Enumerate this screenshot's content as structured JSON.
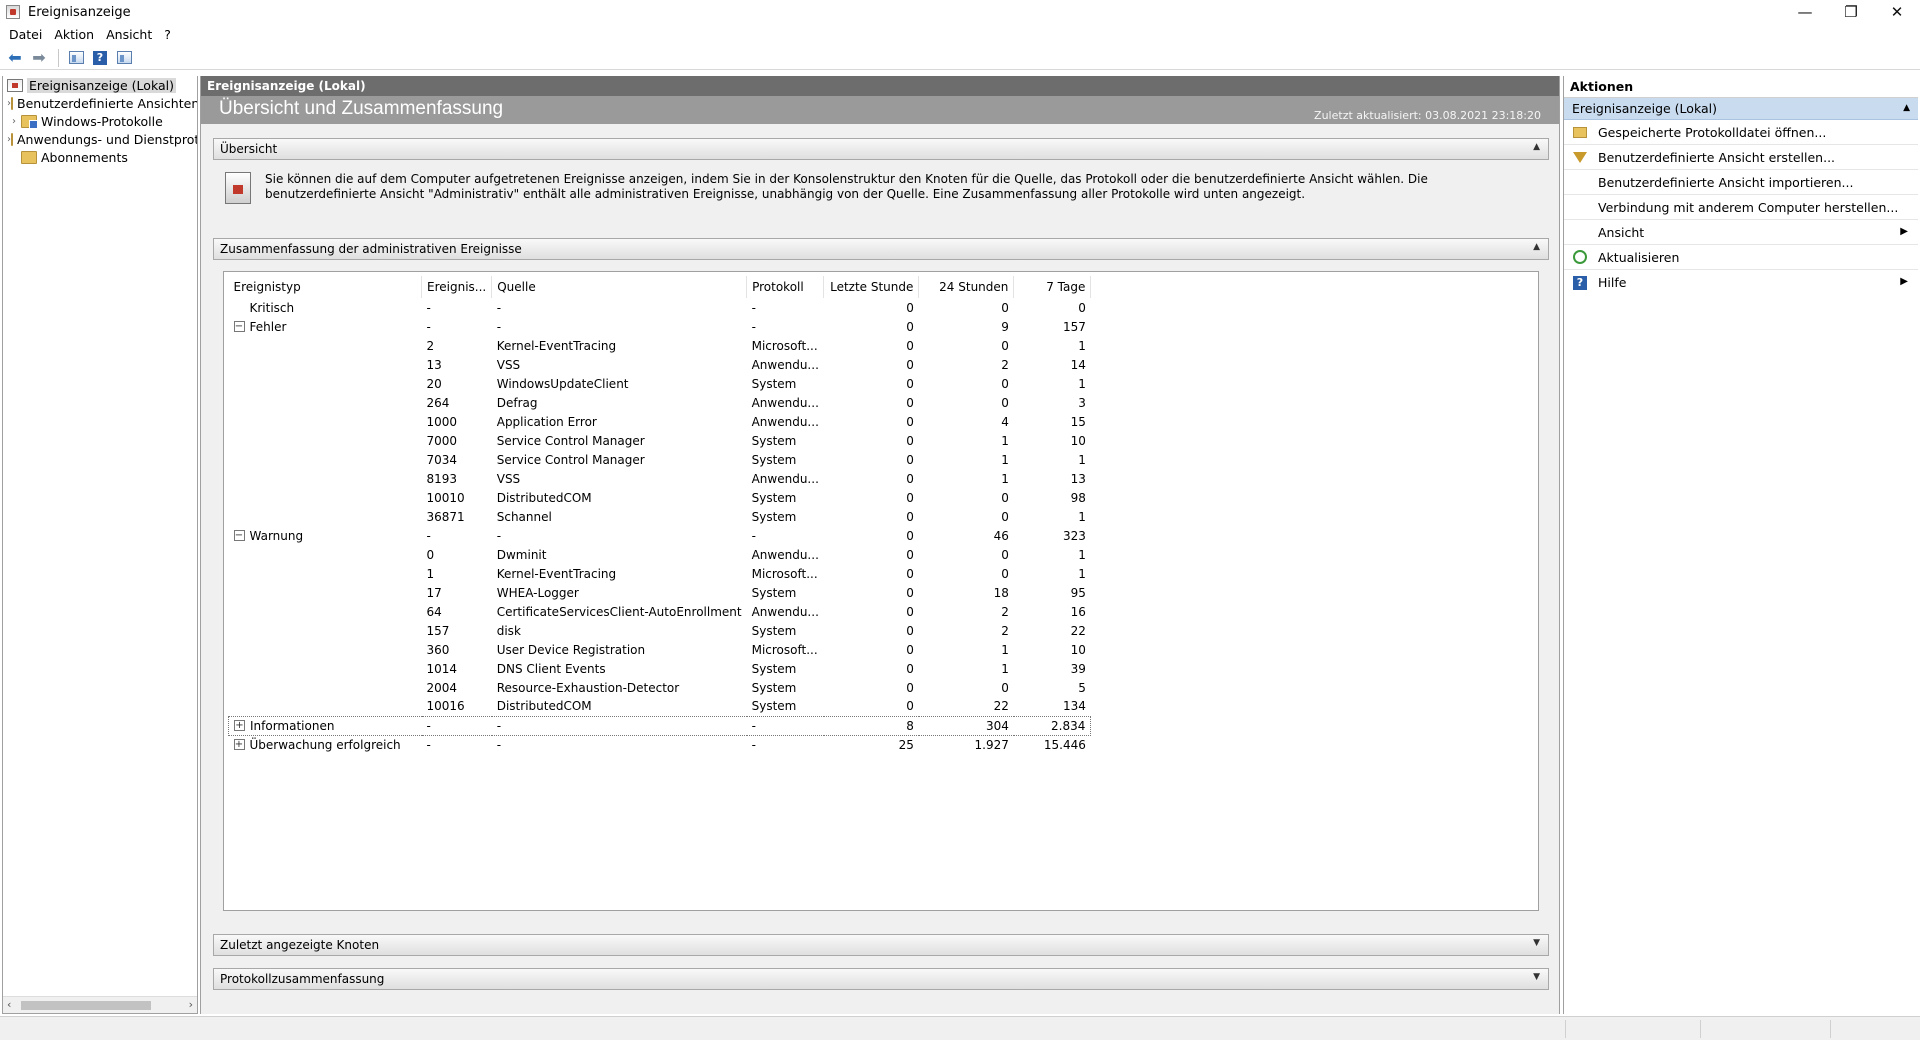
{
  "window": {
    "title": "Ereignisanzeige",
    "minimize": "—",
    "restore": "❐",
    "close": "✕"
  },
  "menu": [
    "Datei",
    "Aktion",
    "Ansicht",
    "?"
  ],
  "tree": {
    "root": "Ereignisanzeige (Lokal)",
    "items": [
      "Benutzerdefinierte Ansichten",
      "Windows-Protokolle",
      "Anwendungs- und Dienstprotokolle",
      "Abonnements"
    ]
  },
  "center": {
    "header": "Ereignisanzeige (Lokal)",
    "title": "Übersicht und Zusammenfassung",
    "updated": "Zuletzt aktualisiert: 03.08.2021 23:18:20",
    "overview_header": "Übersicht",
    "overview_text": "Sie können die auf dem Computer aufgetretenen Ereignisse anzeigen, indem Sie in der Konsolenstruktur den Knoten für die Quelle, das Protokoll oder die benutzerdefinierte Ansicht wählen. Die benutzerdefinierte Ansicht \"Administrativ\" enthält alle administrativen Ereignisse, unabhängig von der Quelle. Eine Zusammenfassung aller Protokolle wird unten angezeigt.",
    "summary_header": "Zusammenfassung der administrativen Ereignisse",
    "recent_header": "Zuletzt angezeigte Knoten",
    "log_summary_header": "Protokollzusammenfassung"
  },
  "table": {
    "columns": [
      "Ereignistyp",
      "Ereignis...",
      "Quelle",
      "Protokoll",
      "Letzte Stunde",
      "24 Stunden",
      "7 Tage"
    ],
    "rows": [
      {
        "type": "Kritisch",
        "toggle": "",
        "id": "-",
        "source": "-",
        "log": "-",
        "hour": "0",
        "day": "0",
        "week": "0"
      },
      {
        "type": "Fehler",
        "toggle": "−",
        "id": "-",
        "source": "-",
        "log": "-",
        "hour": "0",
        "day": "9",
        "week": "157"
      },
      {
        "type": "",
        "toggle": "",
        "id": "2",
        "source": "Kernel-EventTracing",
        "log": "Microsoft...",
        "hour": "0",
        "day": "0",
        "week": "1"
      },
      {
        "type": "",
        "toggle": "",
        "id": "13",
        "source": "VSS",
        "log": "Anwendu...",
        "hour": "0",
        "day": "2",
        "week": "14"
      },
      {
        "type": "",
        "toggle": "",
        "id": "20",
        "source": "WindowsUpdateClient",
        "log": "System",
        "hour": "0",
        "day": "0",
        "week": "1"
      },
      {
        "type": "",
        "toggle": "",
        "id": "264",
        "source": "Defrag",
        "log": "Anwendu...",
        "hour": "0",
        "day": "0",
        "week": "3"
      },
      {
        "type": "",
        "toggle": "",
        "id": "1000",
        "source": "Application Error",
        "log": "Anwendu...",
        "hour": "0",
        "day": "4",
        "week": "15"
      },
      {
        "type": "",
        "toggle": "",
        "id": "7000",
        "source": "Service Control Manager",
        "log": "System",
        "hour": "0",
        "day": "1",
        "week": "10"
      },
      {
        "type": "",
        "toggle": "",
        "id": "7034",
        "source": "Service Control Manager",
        "log": "System",
        "hour": "0",
        "day": "1",
        "week": "1"
      },
      {
        "type": "",
        "toggle": "",
        "id": "8193",
        "source": "VSS",
        "log": "Anwendu...",
        "hour": "0",
        "day": "1",
        "week": "13"
      },
      {
        "type": "",
        "toggle": "",
        "id": "10010",
        "source": "DistributedCOM",
        "log": "System",
        "hour": "0",
        "day": "0",
        "week": "98"
      },
      {
        "type": "",
        "toggle": "",
        "id": "36871",
        "source": "Schannel",
        "log": "System",
        "hour": "0",
        "day": "0",
        "week": "1"
      },
      {
        "type": "Warnung",
        "toggle": "−",
        "id": "-",
        "source": "-",
        "log": "-",
        "hour": "0",
        "day": "46",
        "week": "323"
      },
      {
        "type": "",
        "toggle": "",
        "id": "0",
        "source": "Dwminit",
        "log": "Anwendu...",
        "hour": "0",
        "day": "0",
        "week": "1"
      },
      {
        "type": "",
        "toggle": "",
        "id": "1",
        "source": "Kernel-EventTracing",
        "log": "Microsoft...",
        "hour": "0",
        "day": "0",
        "week": "1"
      },
      {
        "type": "",
        "toggle": "",
        "id": "17",
        "source": "WHEA-Logger",
        "log": "System",
        "hour": "0",
        "day": "18",
        "week": "95"
      },
      {
        "type": "",
        "toggle": "",
        "id": "64",
        "source": "CertificateServicesClient-AutoEnrollment",
        "log": "Anwendu...",
        "hour": "0",
        "day": "2",
        "week": "16"
      },
      {
        "type": "",
        "toggle": "",
        "id": "157",
        "source": "disk",
        "log": "System",
        "hour": "0",
        "day": "2",
        "week": "22"
      },
      {
        "type": "",
        "toggle": "",
        "id": "360",
        "source": "User Device Registration",
        "log": "Microsoft...",
        "hour": "0",
        "day": "1",
        "week": "10"
      },
      {
        "type": "",
        "toggle": "",
        "id": "1014",
        "source": "DNS Client Events",
        "log": "System",
        "hour": "0",
        "day": "1",
        "week": "39"
      },
      {
        "type": "",
        "toggle": "",
        "id": "2004",
        "source": "Resource-Exhaustion-Detector",
        "log": "System",
        "hour": "0",
        "day": "0",
        "week": "5"
      },
      {
        "type": "",
        "toggle": "",
        "id": "10016",
        "source": "DistributedCOM",
        "log": "System",
        "hour": "0",
        "day": "22",
        "week": "134"
      },
      {
        "type": "Informationen",
        "toggle": "+",
        "id": "-",
        "source": "-",
        "log": "-",
        "hour": "8",
        "day": "304",
        "week": "2.834"
      },
      {
        "type": "Überwachung erfolgreich",
        "toggle": "+",
        "id": "-",
        "source": "-",
        "log": "-",
        "hour": "25",
        "day": "1.927",
        "week": "15.446"
      }
    ]
  },
  "actions": {
    "header": "Aktionen",
    "group": "Ereignisanzeige (Lokal)",
    "items": [
      {
        "label": "Gespeicherte Protokolldatei öffnen...",
        "icon": "folder-open-icon"
      },
      {
        "label": "Benutzerdefinierte Ansicht erstellen...",
        "icon": "filter-icon"
      },
      {
        "label": "Benutzerdefinierte Ansicht importieren...",
        "icon": ""
      },
      {
        "label": "Verbindung mit anderem Computer herstellen...",
        "icon": ""
      },
      {
        "label": "Ansicht",
        "icon": "",
        "submenu": true
      },
      {
        "label": "Aktualisieren",
        "icon": "refresh-icon"
      },
      {
        "label": "Hilfe",
        "icon": "help-icon",
        "submenu": true
      }
    ]
  }
}
